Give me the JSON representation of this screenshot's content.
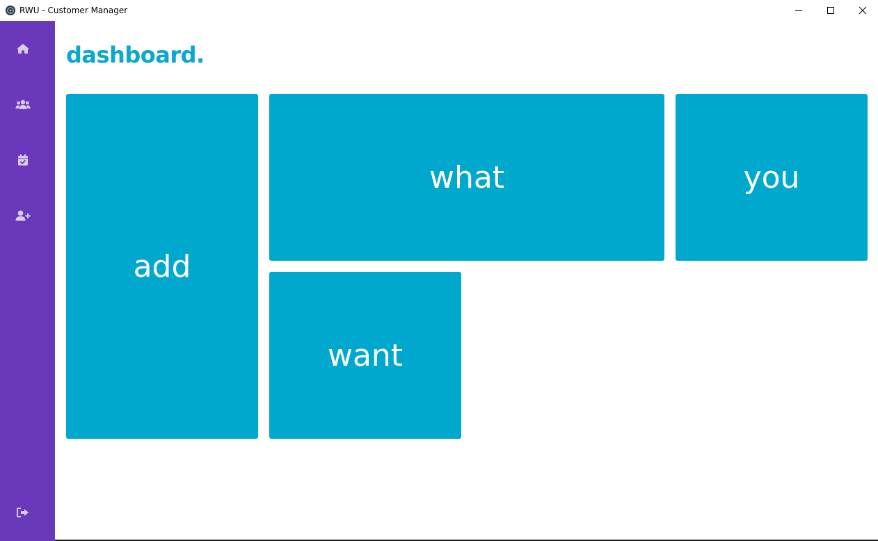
{
  "window": {
    "title": "RWU - Customer Manager",
    "controls": [
      "minimize",
      "maximize",
      "close"
    ]
  },
  "sidebar": {
    "color": "#6a38ba",
    "items": [
      {
        "icon": "home-icon"
      },
      {
        "icon": "users-icon"
      },
      {
        "icon": "calendar-check-icon"
      },
      {
        "icon": "user-plus-icon"
      }
    ],
    "footer": {
      "icon": "sign-out-icon"
    }
  },
  "main": {
    "title": "dashboard.",
    "title_color": "#0aa7cf",
    "tile_color": "#00a8ce",
    "tiles": [
      {
        "label": "add"
      },
      {
        "label": "what"
      },
      {
        "label": "you"
      },
      {
        "label": "want"
      }
    ]
  }
}
